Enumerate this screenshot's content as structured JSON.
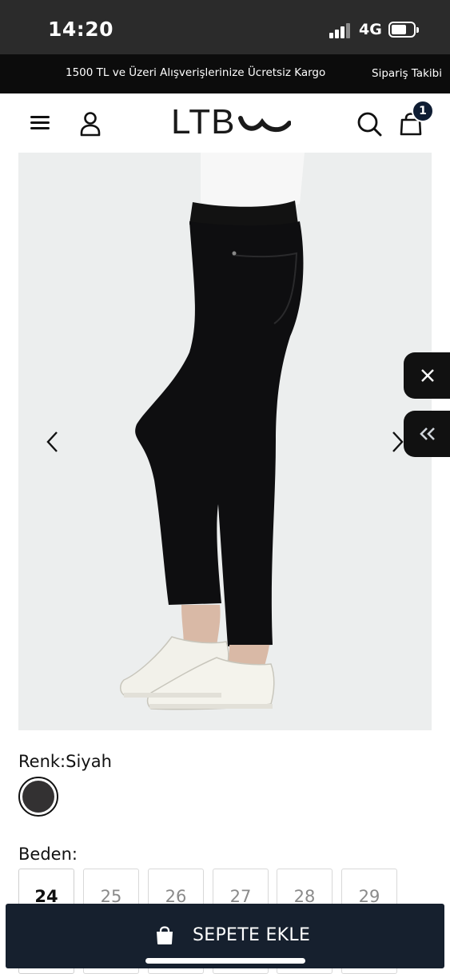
{
  "status_bar": {
    "time": "14:20",
    "network": "4G"
  },
  "promo": {
    "text": "1500 TL ve Üzeri Alışverişlerinize Ücretsiz Kargo",
    "order_tracking": "Sipariş Takibi"
  },
  "header": {
    "logo": "LTB",
    "cart_count": "1"
  },
  "colors": {
    "accent": "#16202e",
    "badge": "#0f1d33",
    "swatch": "#333132"
  },
  "product": {
    "color_label": "Renk:Siyah",
    "size_label": "Beden:",
    "sizes": [
      "24",
      "25",
      "26",
      "27",
      "28",
      "29"
    ],
    "selected_size": "24"
  },
  "cta": {
    "label": "SEPETE EKLE"
  }
}
